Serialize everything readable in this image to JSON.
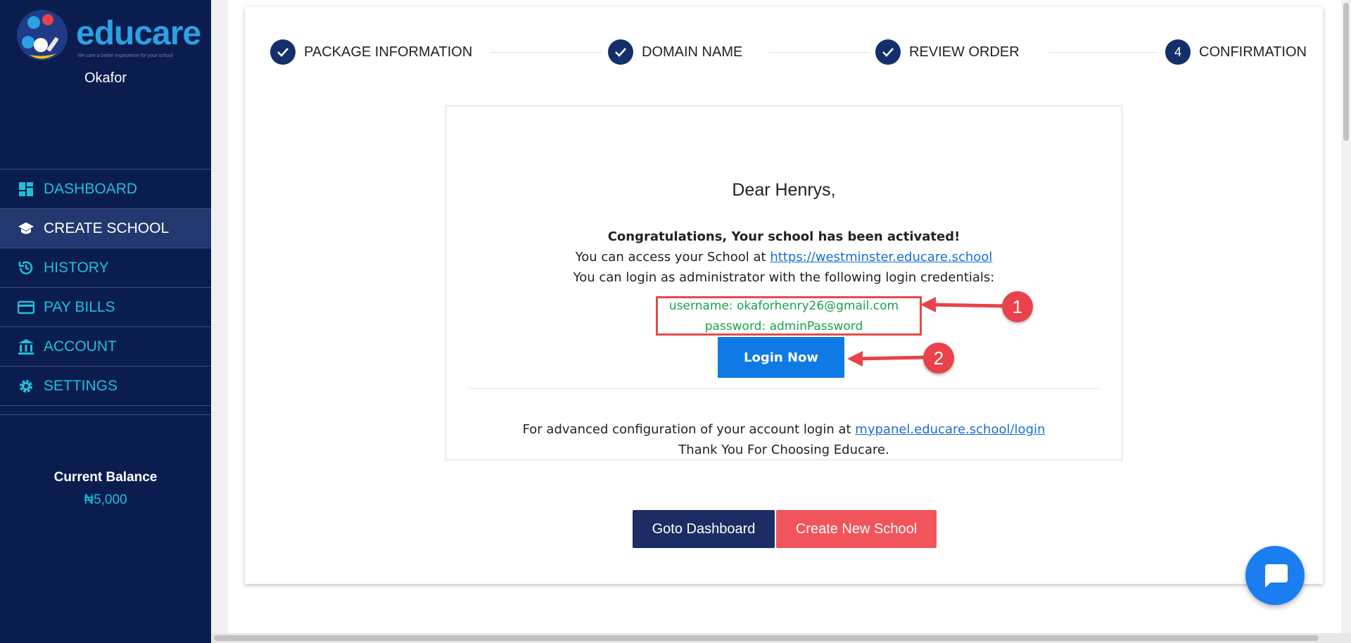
{
  "brand": {
    "name": "educare",
    "tagline": "We care a better experience for your school"
  },
  "sidebar": {
    "user_name": "Okafor",
    "items": [
      {
        "label": "DASHBOARD",
        "icon": "dashboard-icon"
      },
      {
        "label": "CREATE SCHOOL",
        "icon": "graduation-cap-icon"
      },
      {
        "label": "HISTORY",
        "icon": "history-icon"
      },
      {
        "label": "PAY BILLS",
        "icon": "credit-card-icon"
      },
      {
        "label": "ACCOUNT",
        "icon": "bank-icon"
      },
      {
        "label": "SETTINGS",
        "icon": "gear-icon"
      }
    ],
    "active_item": "CREATE SCHOOL",
    "balance_title": "Current Balance",
    "balance_value": "₦5,000"
  },
  "stepper": {
    "steps": [
      {
        "label": "PACKAGE INFORMATION",
        "marker": "check"
      },
      {
        "label": "DOMAIN NAME",
        "marker": "check"
      },
      {
        "label": "REVIEW ORDER",
        "marker": "check"
      },
      {
        "label": "CONFIRMATION",
        "marker": "4"
      }
    ]
  },
  "letter": {
    "greeting": "Dear Henrys,",
    "congrats": "Congratulations, Your school has been activated!",
    "access_prefix": "You can access your School at ",
    "access_link": "https://westminster.educare.school",
    "login_info": "You can login as administrator with the following login credentials:",
    "username_line": "username: okaforhenry26@gmail.com",
    "password_line": "password: adminPassword",
    "login_button": "Login Now",
    "advanced_prefix": "For advanced configuration of your account login at ",
    "advanced_link": "mypanel.educare.school/login",
    "thanks": "Thank You For Choosing Educare."
  },
  "actions": {
    "goto_dashboard": "Goto Dashboard",
    "create_new_school": "Create New School"
  },
  "annotations": {
    "first": "1",
    "second": "2"
  },
  "colors": {
    "sidebar_bg": "#0b1d4f",
    "accent": "#21c0d8",
    "primary_btn": "#0f7ae5",
    "danger_btn": "#f2545b",
    "credentials": "#19a34a",
    "annotation": "#e9424a"
  }
}
